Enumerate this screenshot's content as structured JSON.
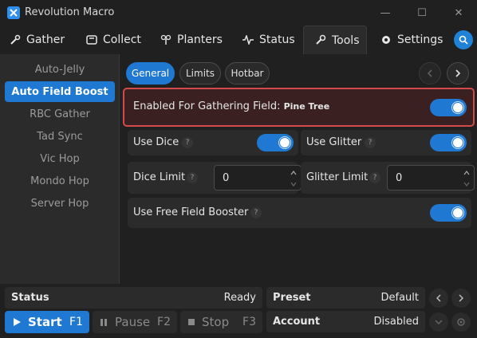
{
  "window": {
    "title": "Revolution Macro",
    "controls": {
      "minimize": "—",
      "maximize": "☐",
      "close": "✕"
    }
  },
  "nav": {
    "tabs": [
      {
        "label": "Gather",
        "icon": "gather-icon"
      },
      {
        "label": "Collect",
        "icon": "collect-icon"
      },
      {
        "label": "Planters",
        "icon": "planters-icon"
      },
      {
        "label": "Status",
        "icon": "status-icon"
      },
      {
        "label": "Tools",
        "icon": "tools-icon",
        "active": true
      },
      {
        "label": "Settings",
        "icon": "settings-icon"
      }
    ],
    "search_icon": "search-icon"
  },
  "sidebar": {
    "items": [
      {
        "label": "Auto-Jelly"
      },
      {
        "label": "Auto Field Boost",
        "active": true
      },
      {
        "label": "RBC Gather"
      },
      {
        "label": "Tad Sync"
      },
      {
        "label": "Vic Hop"
      },
      {
        "label": "Mondo Hop"
      },
      {
        "label": "Server Hop"
      }
    ]
  },
  "main": {
    "subtabs": [
      {
        "label": "General",
        "active": true
      },
      {
        "label": "Limits"
      },
      {
        "label": "Hotbar"
      }
    ],
    "enabled_row": {
      "label": "Enabled For Gathering Field:",
      "field": "Pine Tree",
      "on": true
    },
    "use_dice": {
      "label": "Use Dice",
      "help": "?",
      "on": true
    },
    "use_glitter": {
      "label": "Use Glitter",
      "help": "?",
      "on": true
    },
    "dice_limit": {
      "label": "Dice Limit",
      "help": "?",
      "value": "0"
    },
    "glitter_limit": {
      "label": "Glitter Limit",
      "help": "?",
      "value": "0"
    },
    "free_field_booster": {
      "label": "Use Free Field Booster",
      "help": "?",
      "on": true
    }
  },
  "statusbar": {
    "status": {
      "label": "Status",
      "value": "Ready"
    },
    "preset": {
      "label": "Preset",
      "value": "Default"
    },
    "account": {
      "label": "Account",
      "value": "Disabled"
    },
    "start": {
      "label": "Start",
      "key": "F1"
    },
    "pause": {
      "label": "Pause",
      "key": "F2"
    },
    "stop": {
      "label": "Stop",
      "key": "F3"
    }
  },
  "colors": {
    "accent": "#1f78d1",
    "highlight_border": "#d24a4a",
    "background": "#202020",
    "panel": "#2b2b2b"
  }
}
